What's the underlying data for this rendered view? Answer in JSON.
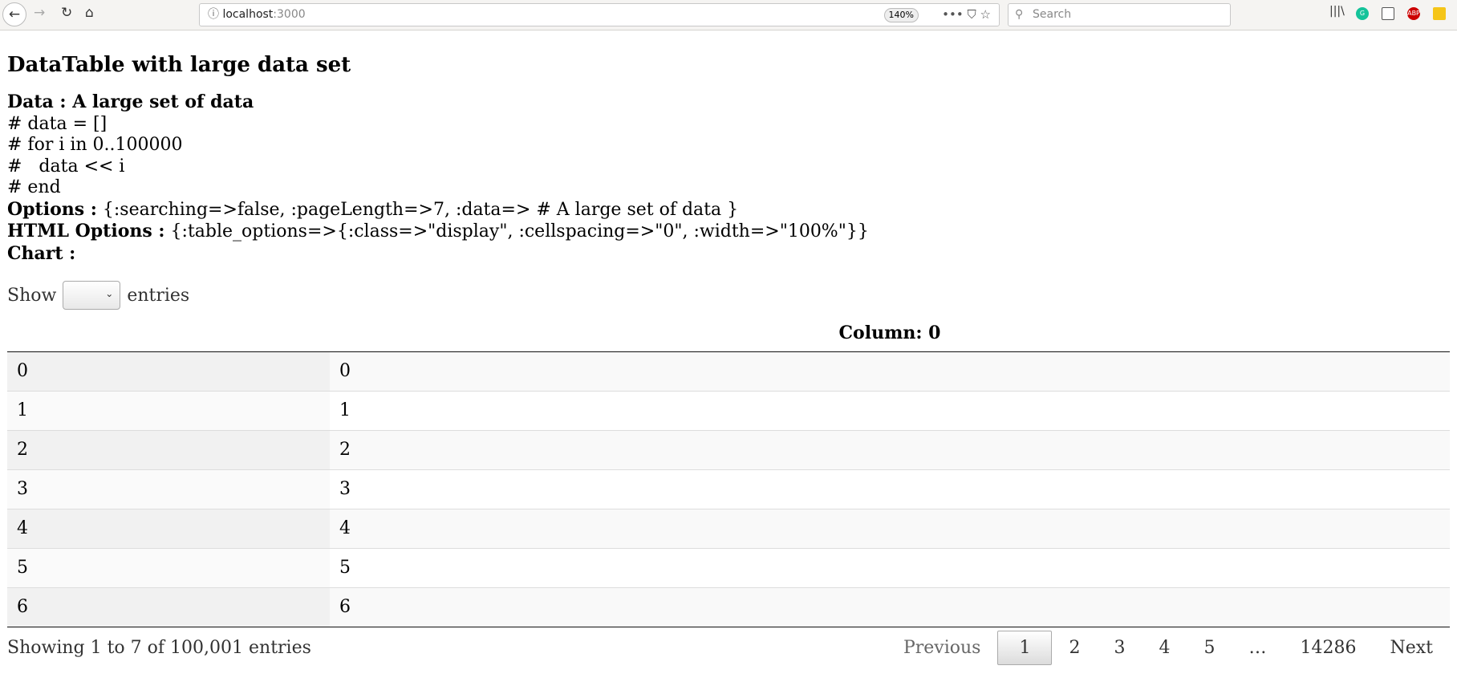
{
  "browser": {
    "url_host": "localhost",
    "url_port": ":3000",
    "zoom": "140%",
    "search_placeholder": "Search"
  },
  "page": {
    "title": "DataTable with large data set",
    "data_label": "Data : A large set of data",
    "code_lines": [
      "# data = []",
      "# for i in 0..100000",
      "#   data << i",
      "# end"
    ],
    "options_label": "Options :",
    "options_value": " {:searching=>false, :pageLength=>7, :data=> # A large set of data }",
    "html_options_label": "HTML Options :",
    "html_options_value": " {:table_options=>{:class=>\"display\", :cellspacing=>\"0\", :width=>\"100%\"}}",
    "chart_label": "Chart :"
  },
  "length": {
    "show": "Show",
    "entries": "entries",
    "selected": ""
  },
  "table": {
    "headers": [
      "",
      "Column: 0"
    ],
    "rows": [
      [
        "0",
        "0"
      ],
      [
        "1",
        "1"
      ],
      [
        "2",
        "2"
      ],
      [
        "3",
        "3"
      ],
      [
        "4",
        "4"
      ],
      [
        "5",
        "5"
      ],
      [
        "6",
        "6"
      ]
    ]
  },
  "footer": {
    "info": "Showing 1 to 7 of 100,001 entries",
    "pagination": {
      "previous": "Previous",
      "pages": [
        "1",
        "2",
        "3",
        "4",
        "5",
        "…",
        "14286"
      ],
      "next": "Next",
      "current": "1"
    }
  }
}
